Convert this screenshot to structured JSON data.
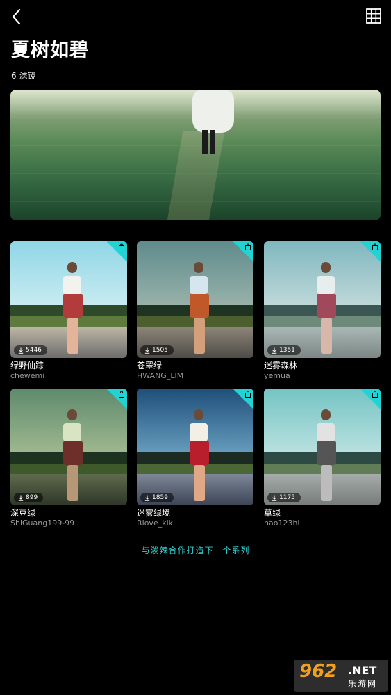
{
  "header": {
    "title": "夏树如碧",
    "subtitle": "6 滤镜"
  },
  "icons": {
    "back": "back-chevron-icon",
    "grid": "grid-view-icon",
    "corner": "shopping-bag-icon",
    "download": "download-icon"
  },
  "accent_color": "#22d3d3",
  "filters": [
    {
      "name": "绿野仙踪",
      "author": "chewemi",
      "downloads": "5446"
    },
    {
      "name": "苍翠绿",
      "author": "HWANG_LIM",
      "downloads": "1505"
    },
    {
      "name": "迷雾森林",
      "author": "yemua",
      "downloads": "1351"
    },
    {
      "name": "深豆绿",
      "author": "ShiGuang199-99",
      "downloads": "899"
    },
    {
      "name": "迷雾绿境",
      "author": "Rlove_kiki",
      "downloads": "1859"
    },
    {
      "name": "草绿",
      "author": "hao123hl",
      "downloads": "1175"
    }
  ],
  "footer": {
    "link_text": "与泼辣合作打造下一个系列"
  },
  "watermark": {
    "logo": "962",
    "domain": ".NET",
    "sub": "乐游网"
  }
}
